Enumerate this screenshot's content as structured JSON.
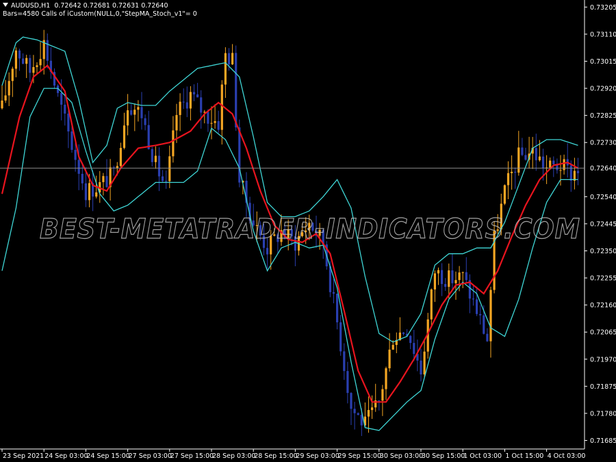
{
  "window": {
    "symbol": "AUDUSD,H1",
    "ohlc": "0.72642 0.72681 0.72631 0.72640",
    "info": "Bars=4580  Calls of iCustom(NULL,0,\"StepMA_Stoch_v1\"= 0"
  },
  "watermark": "BEST-METATRADER-INDICATORS.COM",
  "colors": {
    "background": "#000000",
    "axis": "#ffffff",
    "bull_candle": "#f5a623",
    "bear_candle": "#2a3fb0",
    "step_ma": "#e8141e",
    "bands": "#3fd6d6",
    "price_line": "#8c8c8c"
  },
  "chart_data": {
    "type": "candlestick",
    "current_price": "0.72640",
    "current_value": 0.7264,
    "y_ticks": [
      "0.73205",
      "0.73110",
      "0.73015",
      "0.72920",
      "0.72825",
      "0.72730",
      "0.72540",
      "0.72445",
      "0.72350",
      "0.72255",
      "0.72160",
      "0.72065",
      "0.71970",
      "0.71875",
      "0.71780",
      "0.71685"
    ],
    "y_tick_values": [
      0.73205,
      0.7311,
      0.73015,
      0.7292,
      0.72825,
      0.7273,
      0.7254,
      0.72445,
      0.7235,
      0.72255,
      0.7216,
      0.72065,
      0.7197,
      0.71875,
      0.7178,
      0.71685
    ],
    "ylim": [
      0.71655,
      0.73225
    ],
    "x_ticks": [
      "23 Sep 2021",
      "24 Sep 03:00",
      "24 Sep 15:00",
      "27 Sep 03:00",
      "27 Sep 15:00",
      "28 Sep 03:00",
      "28 Sep 15:00",
      "29 Sep 03:00",
      "29 Sep 15:00",
      "30 Sep 03:00",
      "30 Sep 15:00",
      "1 Oct 03:00",
      "1 Oct 15:00",
      "4 Oct 03:00"
    ],
    "x_tick_bars": [
      0,
      12,
      24,
      36,
      48,
      60,
      72,
      84,
      96,
      108,
      120,
      132,
      144,
      156
    ],
    "bar_count": 166,
    "anchors": [
      [
        0,
        0.7285
      ],
      [
        4,
        0.7306
      ],
      [
        8,
        0.7298
      ],
      [
        12,
        0.7308
      ],
      [
        16,
        0.7289
      ],
      [
        20,
        0.7272
      ],
      [
        24,
        0.7256
      ],
      [
        28,
        0.7258
      ],
      [
        32,
        0.7262
      ],
      [
        36,
        0.7287
      ],
      [
        40,
        0.7283
      ],
      [
        44,
        0.7265
      ],
      [
        47,
        0.7257
      ],
      [
        50,
        0.7283
      ],
      [
        54,
        0.729
      ],
      [
        58,
        0.7283
      ],
      [
        62,
        0.728
      ],
      [
        64,
        0.7304
      ],
      [
        66,
        0.7302
      ],
      [
        68,
        0.726
      ],
      [
        72,
        0.7245
      ],
      [
        76,
        0.7236
      ],
      [
        80,
        0.7242
      ],
      [
        84,
        0.7238
      ],
      [
        88,
        0.7245
      ],
      [
        92,
        0.7238
      ],
      [
        96,
        0.721
      ],
      [
        100,
        0.718
      ],
      [
        104,
        0.7174
      ],
      [
        108,
        0.7182
      ],
      [
        112,
        0.7205
      ],
      [
        116,
        0.7208
      ],
      [
        120,
        0.7193
      ],
      [
        124,
        0.7228
      ],
      [
        128,
        0.7225
      ],
      [
        132,
        0.7226
      ],
      [
        136,
        0.7214
      ],
      [
        139,
        0.7204
      ],
      [
        141,
        0.7239
      ],
      [
        144,
        0.7256
      ],
      [
        148,
        0.7268
      ],
      [
        152,
        0.727
      ],
      [
        156,
        0.7264
      ],
      [
        160,
        0.7265
      ],
      [
        163,
        0.7262
      ],
      [
        165,
        0.7264
      ]
    ],
    "step_ma": [
      [
        0,
        0.7255
      ],
      [
        5,
        0.7282
      ],
      [
        9,
        0.7296
      ],
      [
        13,
        0.73
      ],
      [
        18,
        0.7291
      ],
      [
        22,
        0.7268
      ],
      [
        26,
        0.7258
      ],
      [
        30,
        0.7256
      ],
      [
        34,
        0.7264
      ],
      [
        39,
        0.7271
      ],
      [
        44,
        0.7272
      ],
      [
        48,
        0.7273
      ],
      [
        54,
        0.7277
      ],
      [
        58,
        0.7283
      ],
      [
        62,
        0.7287
      ],
      [
        66,
        0.7283
      ],
      [
        70,
        0.7271
      ],
      [
        74,
        0.7256
      ],
      [
        78,
        0.7244
      ],
      [
        82,
        0.7239
      ],
      [
        86,
        0.7238
      ],
      [
        90,
        0.7241
      ],
      [
        94,
        0.7234
      ],
      [
        98,
        0.7214
      ],
      [
        102,
        0.7193
      ],
      [
        106,
        0.7182
      ],
      [
        110,
        0.7182
      ],
      [
        114,
        0.7189
      ],
      [
        118,
        0.7197
      ],
      [
        122,
        0.7206
      ],
      [
        126,
        0.7216
      ],
      [
        130,
        0.7223
      ],
      [
        134,
        0.7224
      ],
      [
        138,
        0.722
      ],
      [
        142,
        0.7228
      ],
      [
        146,
        0.724
      ],
      [
        150,
        0.7251
      ],
      [
        154,
        0.726
      ],
      [
        158,
        0.7265
      ],
      [
        162,
        0.7266
      ],
      [
        165,
        0.7264
      ]
    ],
    "upper_band": [
      [
        0,
        0.7293
      ],
      [
        4,
        0.7308
      ],
      [
        6,
        0.731
      ],
      [
        10,
        0.7309
      ],
      [
        14,
        0.7307
      ],
      [
        18,
        0.7305
      ],
      [
        22,
        0.7288
      ],
      [
        26,
        0.7266
      ],
      [
        30,
        0.7272
      ],
      [
        33,
        0.7285
      ],
      [
        36,
        0.7287
      ],
      [
        40,
        0.7286
      ],
      [
        44,
        0.7286
      ],
      [
        48,
        0.7291
      ],
      [
        52,
        0.7295
      ],
      [
        56,
        0.7299
      ],
      [
        60,
        0.73
      ],
      [
        64,
        0.7301
      ],
      [
        68,
        0.7296
      ],
      [
        72,
        0.7275
      ],
      [
        76,
        0.7252
      ],
      [
        80,
        0.7247
      ],
      [
        84,
        0.7247
      ],
      [
        88,
        0.7249
      ],
      [
        92,
        0.7254
      ],
      [
        96,
        0.726
      ],
      [
        100,
        0.725
      ],
      [
        104,
        0.7226
      ],
      [
        108,
        0.7206
      ],
      [
        112,
        0.7203
      ],
      [
        116,
        0.7205
      ],
      [
        120,
        0.7213
      ],
      [
        124,
        0.723
      ],
      [
        128,
        0.7234
      ],
      [
        132,
        0.7234
      ],
      [
        136,
        0.7236
      ],
      [
        140,
        0.7236
      ],
      [
        144,
        0.7245
      ],
      [
        148,
        0.7258
      ],
      [
        152,
        0.7271
      ],
      [
        156,
        0.7274
      ],
      [
        160,
        0.7274
      ],
      [
        165,
        0.7272
      ]
    ],
    "lower_band": [
      [
        0,
        0.7228
      ],
      [
        4,
        0.725
      ],
      [
        8,
        0.7282
      ],
      [
        12,
        0.7292
      ],
      [
        16,
        0.7292
      ],
      [
        20,
        0.7287
      ],
      [
        24,
        0.727
      ],
      [
        28,
        0.7255
      ],
      [
        32,
        0.7249
      ],
      [
        36,
        0.7251
      ],
      [
        40,
        0.7255
      ],
      [
        44,
        0.7259
      ],
      [
        48,
        0.7259
      ],
      [
        52,
        0.7259
      ],
      [
        56,
        0.7263
      ],
      [
        60,
        0.7278
      ],
      [
        64,
        0.7274
      ],
      [
        68,
        0.7264
      ],
      [
        72,
        0.7242
      ],
      [
        76,
        0.7228
      ],
      [
        80,
        0.7236
      ],
      [
        84,
        0.7238
      ],
      [
        88,
        0.7236
      ],
      [
        92,
        0.7237
      ],
      [
        96,
        0.7222
      ],
      [
        100,
        0.7196
      ],
      [
        104,
        0.7173
      ],
      [
        108,
        0.7172
      ],
      [
        112,
        0.7177
      ],
      [
        116,
        0.7182
      ],
      [
        120,
        0.7186
      ],
      [
        124,
        0.7204
      ],
      [
        128,
        0.7218
      ],
      [
        132,
        0.7224
      ],
      [
        136,
        0.722
      ],
      [
        140,
        0.7208
      ],
      [
        144,
        0.7205
      ],
      [
        148,
        0.7218
      ],
      [
        152,
        0.7236
      ],
      [
        156,
        0.7252
      ],
      [
        160,
        0.726
      ],
      [
        165,
        0.726
      ]
    ]
  }
}
